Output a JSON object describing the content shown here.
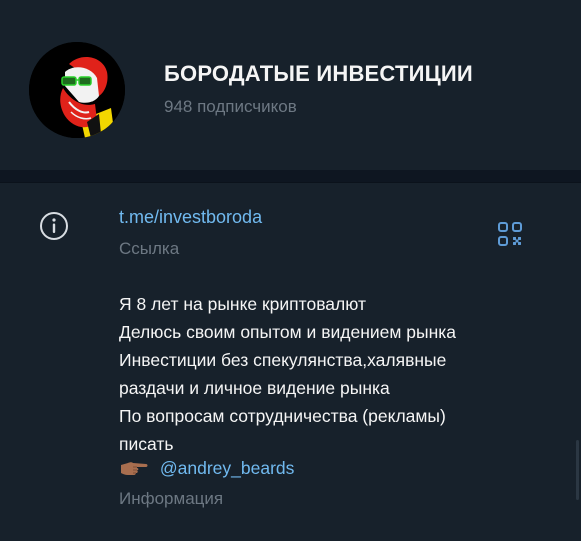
{
  "channel": {
    "title": "БОРОДАТЫЕ ИНВЕСТИЦИИ",
    "subscribers": "948 подписчиков",
    "avatar_icon": "bearded-man-with-glasses-avatar"
  },
  "info": {
    "icon": "info-icon",
    "link": "t.me/investboroda",
    "link_caption": "Ссылка",
    "qr_icon": "qr-code-icon",
    "description_lines": [
      "Я 8 лет на рынке криптовалют",
      "Делюсь своим опытом и видением рынка",
      "Инвестиции без спекулянства,халявные",
      "раздачи и личное видение рынка",
      "По вопросам сотрудничества (рекламы)",
      "писать"
    ],
    "mention_emoji_icon": "pointing-right-hand-icon",
    "mention": "@andrey_beards",
    "info_caption": "Информация"
  },
  "colors": {
    "background": "#17212b",
    "divider": "#0e1621",
    "link": "#71baf0",
    "muted": "#6d7883",
    "text": "#f5f5f5"
  }
}
